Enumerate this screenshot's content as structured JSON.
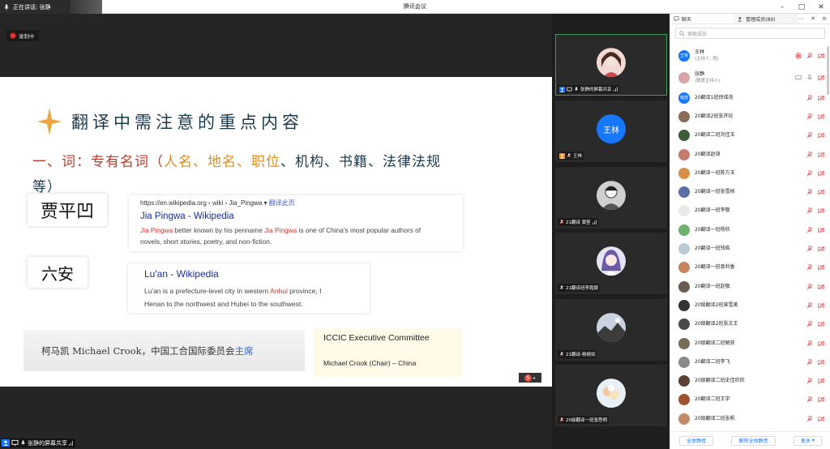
{
  "titlebar": {
    "speaking_label": "正在讲话: 张静",
    "app_title": "腾讯会议"
  },
  "recording": {
    "label": "录制中"
  },
  "slide": {
    "title": "翻译中需注意的重点内容",
    "heading_prefix": "一、词：专有名词（",
    "heading_names": "人名、地名、职位",
    "heading_rest": "、机构、书籍、法律法规",
    "heading_line2": "等）",
    "word_jia": "贾平凹",
    "word_luan": "六安",
    "card_jia": {
      "url_main": "https://en.wikipedia.org",
      "url_path": " › wiki › Jia_Pingwa",
      "translate": "翻译此页",
      "title": "Jia Pingwa - Wikipedia",
      "desc_name1": "Jia Pingwa",
      "desc_mid": " better known by his penname ",
      "desc_name2": "Jia Pingwa",
      "desc_end": " is one of China's most popular authors of",
      "desc_line2": "novels, short stories, poetry, and non-fiction."
    },
    "card_luan": {
      "title": "Lu'an - Wikipedia",
      "desc_start": "Lu'an is a prefecture-level city in western ",
      "desc_hl": "Anhui",
      "desc_end": " province, I",
      "desc_line2": "Henan to the northwest and Hubei to the southwest."
    },
    "crook_text": "柯马凯 Michael Crook，中国工合国际委员会",
    "crook_hl": "主席",
    "iccic_title": "ICCIC Executive Committee",
    "iccic_sub": "Michael Crook (Chair) – China"
  },
  "share_label": "张静的屏幕共享",
  "videos": [
    {
      "name": "张静的屏幕共享",
      "avatar": "girl",
      "active": true
    },
    {
      "name": "王林",
      "avatar_text": "王林"
    },
    {
      "name": "21翻译 黄笙",
      "avatar": "sketch"
    },
    {
      "name": "21翻译班李霞娱",
      "avatar": "anime"
    },
    {
      "name": "21翻译-杨婉如",
      "avatar": "landscape"
    },
    {
      "name": "20级翻译一班张思明",
      "avatar": "flower"
    }
  ],
  "panel": {
    "tab_chat": "聊天",
    "tab_members": "管理成员(89)",
    "search_placeholder": "搜索成员",
    "members": [
      {
        "name": "王林",
        "sub": "(主持人, 我)",
        "color": "#1677ff",
        "initials": "王林",
        "rec": true
      },
      {
        "name": "张静",
        "sub": "(联席主持人)",
        "color": "#d9a6a6",
        "initials": ""
      },
      {
        "name": "20翻译1班徐瑶茂",
        "color": "#1677ff",
        "initials": "瑶茂"
      },
      {
        "name": "20翻译2班张开珍",
        "color": "#8a6d57",
        "initials": ""
      },
      {
        "name": "20翻译二班刘佳玉",
        "color": "#3c5e3a",
        "initials": ""
      },
      {
        "name": "20翻译赵琦",
        "color": "#c47b6b",
        "initials": ""
      },
      {
        "name": "20翻译一班陈方玉",
        "color": "#d98e4a",
        "initials": ""
      },
      {
        "name": "20翻译一班张雪桢",
        "color": "#5a6ea8",
        "initials": ""
      },
      {
        "name": "20翻译一班李敬",
        "color": "#e9e9e9",
        "initials": ""
      },
      {
        "name": "20翻译一班杨欣",
        "color": "#6bb36d",
        "initials": ""
      },
      {
        "name": "20翻译一班钱皓",
        "color": "#b9c9d6",
        "initials": ""
      },
      {
        "name": "20翻译一班袁利香",
        "color": "#c9855d",
        "initials": ""
      },
      {
        "name": "20翻译一班赵敬",
        "color": "#6b5a4f",
        "initials": ""
      },
      {
        "name": "20级翻译2班曾雪美",
        "color": "#333333",
        "initials": ""
      },
      {
        "name": "20级翻译2班张文王",
        "color": "#4a4a4a",
        "initials": ""
      },
      {
        "name": "20级翻译二班解获",
        "color": "#7a6a5a",
        "initials": ""
      },
      {
        "name": "20翻译二班李飞",
        "color": "#8b8b8b",
        "initials": ""
      },
      {
        "name": "20级翻译二班史佳欣欣",
        "color": "#5c4033",
        "initials": ""
      },
      {
        "name": "20翻译二班王宇",
        "color": "#a0522d",
        "initials": ""
      },
      {
        "name": "20级翻译二班张帆",
        "color": "#c08a6a",
        "initials": ""
      }
    ],
    "footer": {
      "mute_all": "全体静音",
      "unmute_all": "解除全体静音",
      "more": "更多"
    }
  }
}
